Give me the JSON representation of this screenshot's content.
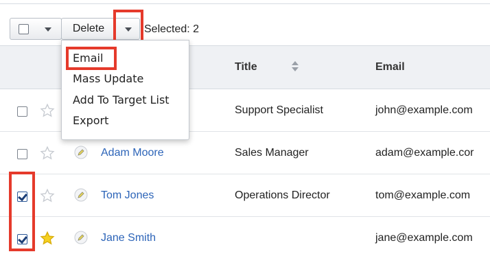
{
  "toolbar": {
    "delete_label": "Delete",
    "selected_text": "Selected: 2"
  },
  "menu": {
    "items": [
      "Email",
      "Mass Update",
      "Add To Target List",
      "Export"
    ]
  },
  "table": {
    "columns": [
      "Title",
      "Email"
    ],
    "rows": [
      {
        "name": "",
        "title": "Support Specialist",
        "email": "john@example.com",
        "checked": false,
        "favorite": false
      },
      {
        "name": "Adam Moore",
        "title": "Sales Manager",
        "email": "adam@example.cor",
        "checked": false,
        "favorite": false
      },
      {
        "name": "Tom Jones",
        "title": "Operations Director",
        "email": "tom@example.com",
        "checked": true,
        "favorite": false
      },
      {
        "name": "Jane Smith",
        "title": "",
        "email": "jane@example.com",
        "checked": true,
        "favorite": true
      }
    ]
  },
  "colors": {
    "highlight": "#e53a2b",
    "link": "#2c64b8",
    "star_active": "#f5d020",
    "header_bg": "#eff1f4"
  },
  "icons": [
    "checkbox-icon",
    "chevron-down-icon",
    "sort-icon",
    "star-icon",
    "pencil-icon"
  ]
}
